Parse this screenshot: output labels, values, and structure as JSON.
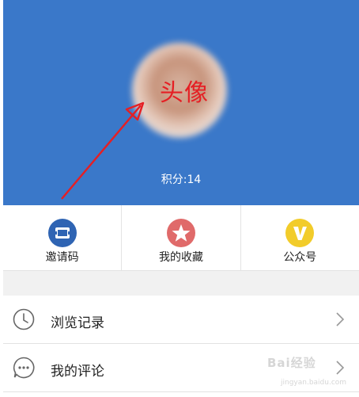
{
  "profile": {
    "avatar_annotation": "头像",
    "points_text": "积分:14"
  },
  "quick_actions": [
    {
      "label": "邀请码",
      "icon": "ticket-icon",
      "color": "#2f64b3"
    },
    {
      "label": "我的收藏",
      "icon": "star-icon",
      "color": "#e06a6a"
    },
    {
      "label": "公众号",
      "icon": "v-icon",
      "color": "#f2cc2a"
    }
  ],
  "menu": [
    {
      "label": "浏览记录",
      "icon": "clock-icon"
    },
    {
      "label": "我的评论",
      "icon": "comment-icon"
    }
  ],
  "watermark": {
    "text": "Bai经验",
    "sub": "jingyan.baidu.com"
  },
  "colors": {
    "header_bg": "#3a78c9",
    "annotation": "#e51f24"
  }
}
